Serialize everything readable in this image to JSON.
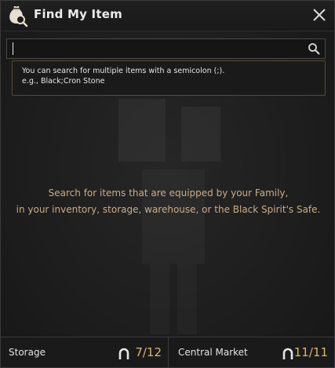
{
  "window": {
    "title": "Find My Item",
    "title_icon": "money-bag-magnifier-icon",
    "close_icon": "close-icon"
  },
  "search": {
    "value": "",
    "placeholder": "",
    "icon": "search-icon"
  },
  "tooltip": {
    "line1": "You can search for multiple items with a semicolon (;).",
    "line2": "e.g., Black;Cron Stone"
  },
  "hint": {
    "line1": "Search for items that are equipped by your Family,",
    "line2": "in your inventory, storage, warehouse, or the Black Spirit's Safe."
  },
  "footer": {
    "storage": {
      "label": "Storage",
      "count": "7/12",
      "icon": "horseshoe-icon"
    },
    "market": {
      "label": "Central Market",
      "count": "11/11",
      "icon": "horseshoe-icon"
    }
  },
  "colors": {
    "accent_gold": "#c9ae84",
    "count_gold": "#d9b66a",
    "background": "#1b1b1b"
  }
}
